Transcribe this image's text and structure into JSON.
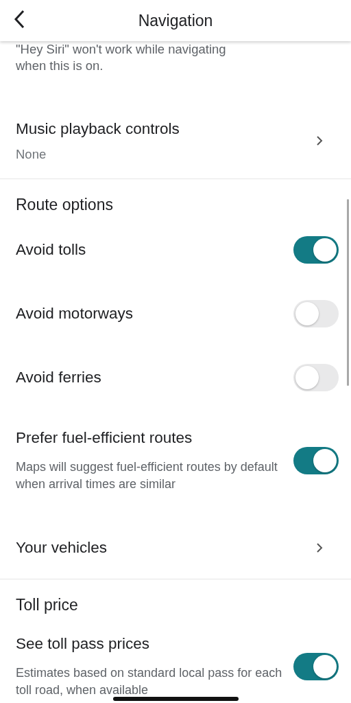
{
  "header": {
    "title": "Navigation"
  },
  "top_note": "\"Hey Siri\" won't work while navigating when this is on.",
  "sections": [
    {
      "items": [
        {
          "kind": "link",
          "title": "Music playback controls",
          "value": "None"
        }
      ]
    },
    {
      "heading": "Route options",
      "items": [
        {
          "kind": "toggle",
          "title": "Avoid tolls",
          "on": true
        },
        {
          "kind": "toggle",
          "title": "Avoid motorways",
          "on": false
        },
        {
          "kind": "toggle",
          "title": "Avoid ferries",
          "on": false
        },
        {
          "kind": "toggle",
          "title": "Prefer fuel-efficient routes",
          "description": "Maps will suggest fuel-efficient routes by default when arrival times are similar",
          "on": true
        },
        {
          "kind": "link",
          "title": "Your vehicles"
        }
      ]
    },
    {
      "heading": "Toll price",
      "items": [
        {
          "kind": "toggle",
          "title": "See toll pass prices",
          "description": "Estimates based on standard local pass for each toll road, when available",
          "on": true
        }
      ]
    }
  ]
}
